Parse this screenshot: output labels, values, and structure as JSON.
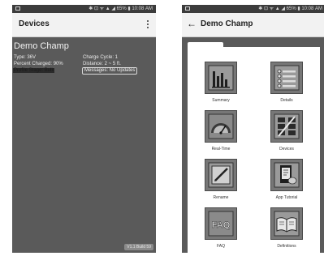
{
  "left_screen": {
    "status_bar": {
      "right_text": "✱ ⊡ ᯤ ▲ ◢ 65% ▮ 10:08 AM"
    },
    "app_bar": {
      "title": "Devices",
      "menu_icon": "overflow-menu-icon"
    },
    "device": {
      "name": "Demo Champ",
      "type": "Type: 36V",
      "percent_charged": "Percent Charged: 90%",
      "profile_stage": "Profile Stage: Bulk",
      "charge_cycle": "Charge Cycle: 1",
      "distance": "Distance: 2 ~ 5 ft.",
      "messages": "Messages: No Updates"
    },
    "version": "V1.1 Build 59"
  },
  "right_screen": {
    "status_bar": {
      "right_text": "✱ ⊡ ᯤ ▲ ◢ 65% ▮ 10:08 AM"
    },
    "app_bar": {
      "title": "Demo Champ",
      "back_icon": "back-arrow-icon"
    },
    "menu": [
      {
        "label": "Summary",
        "icon": "bar-chart-icon"
      },
      {
        "label": "Details",
        "icon": "list-icon"
      },
      {
        "label": "Real-Time",
        "icon": "gauge-icon"
      },
      {
        "label": "Devices",
        "icon": "devices-grid-icon"
      },
      {
        "label": "Rename",
        "icon": "pencil-icon"
      },
      {
        "label": "App Tutorial",
        "icon": "tablet-hand-icon"
      },
      {
        "label": "FAQ",
        "icon": "faq-icon"
      },
      {
        "label": "Definitions",
        "icon": "open-book-icon"
      }
    ]
  }
}
